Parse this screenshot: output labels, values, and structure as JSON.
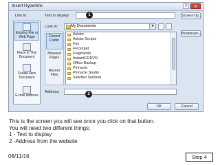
{
  "dialog": {
    "title": "Insert Hyperlink",
    "help_glyph": "?",
    "close_glyph": "✕",
    "link_to_label": "Link to:",
    "text_to_display_label": "Text to display:",
    "text_to_display_value": "",
    "screentip_button": "ScreenTip...",
    "bookmark_button": "Bookmark...",
    "look_in_label": "Look in:",
    "look_in_value": "My Documents",
    "address_label": "Address:",
    "address_value": "",
    "ok_button": "OK",
    "cancel_button": "Cancel",
    "link_to_items": [
      {
        "label": "Existing File or Web Page",
        "icon": "globe-file-icon"
      },
      {
        "label": "Place in This Document",
        "icon": "document-place-icon"
      },
      {
        "label": "Create New Document",
        "icon": "new-document-icon"
      },
      {
        "label": "E-mail Address",
        "icon": "email-icon"
      }
    ],
    "places": [
      {
        "label": "Current Folder"
      },
      {
        "label": "Browsed Pages"
      },
      {
        "label": "Recent Files"
      }
    ],
    "files": [
      "Adobe",
      "Adobe Scripts",
      "Fax",
      "FFOutput",
      "Fragments",
      "InstantCDDVD",
      "Office Backup",
      "Pinnacle",
      "Pinnacle Studio",
      "SafeNet Sentinel"
    ],
    "callouts": [
      "1",
      "2"
    ]
  },
  "caption": {
    "lines": [
      "This is the screen you will see once you click on that button.",
      "You will need two different things:",
      "1 - Text to display",
      "2 -Address from the website"
    ]
  },
  "footer": {
    "date": "08/11/16",
    "step": "Step 4"
  }
}
